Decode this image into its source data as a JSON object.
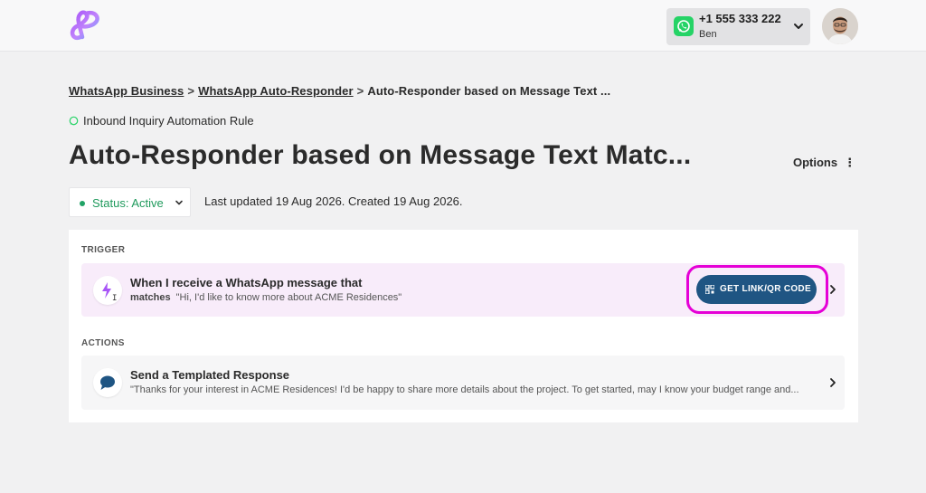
{
  "header": {
    "account_phone": "+1 555 333 222",
    "account_name": "Ben",
    "brand_color": "#8b5cf6"
  },
  "breadcrumb": {
    "items": [
      "WhatsApp Business",
      "WhatsApp Auto-Responder",
      "Auto-Responder based on Message Text ..."
    ],
    "separator": ">"
  },
  "rule": {
    "subtitle": "Inbound Inquiry Automation Rule",
    "title": "Auto-Responder based on Message Text Matc...",
    "options_label": "Options",
    "status_label": "Status: Active",
    "status_color": "#1f9a5c",
    "updated_text": "Last updated 19 Aug 2026. Created 19 Aug 2026."
  },
  "trigger": {
    "section_label": "TRIGGER",
    "title": "When I receive a WhatsApp message that",
    "condition": "matches",
    "match_text": "\"Hi, I'd like to know more about ACME Residences\"",
    "button_label": "GET LINK/QR CODE",
    "icons": [
      "lightning-icon",
      "text-cursor-icon"
    ]
  },
  "actions": {
    "section_label": "ACTIONS",
    "items": [
      {
        "title": "Send a Templated Response",
        "preview": "\"Thanks for your interest in ACME Residences! I'd be happy to share more details about the project. To get started, may I know your budget range and...",
        "icon": "chat-bubble-icon"
      }
    ]
  }
}
